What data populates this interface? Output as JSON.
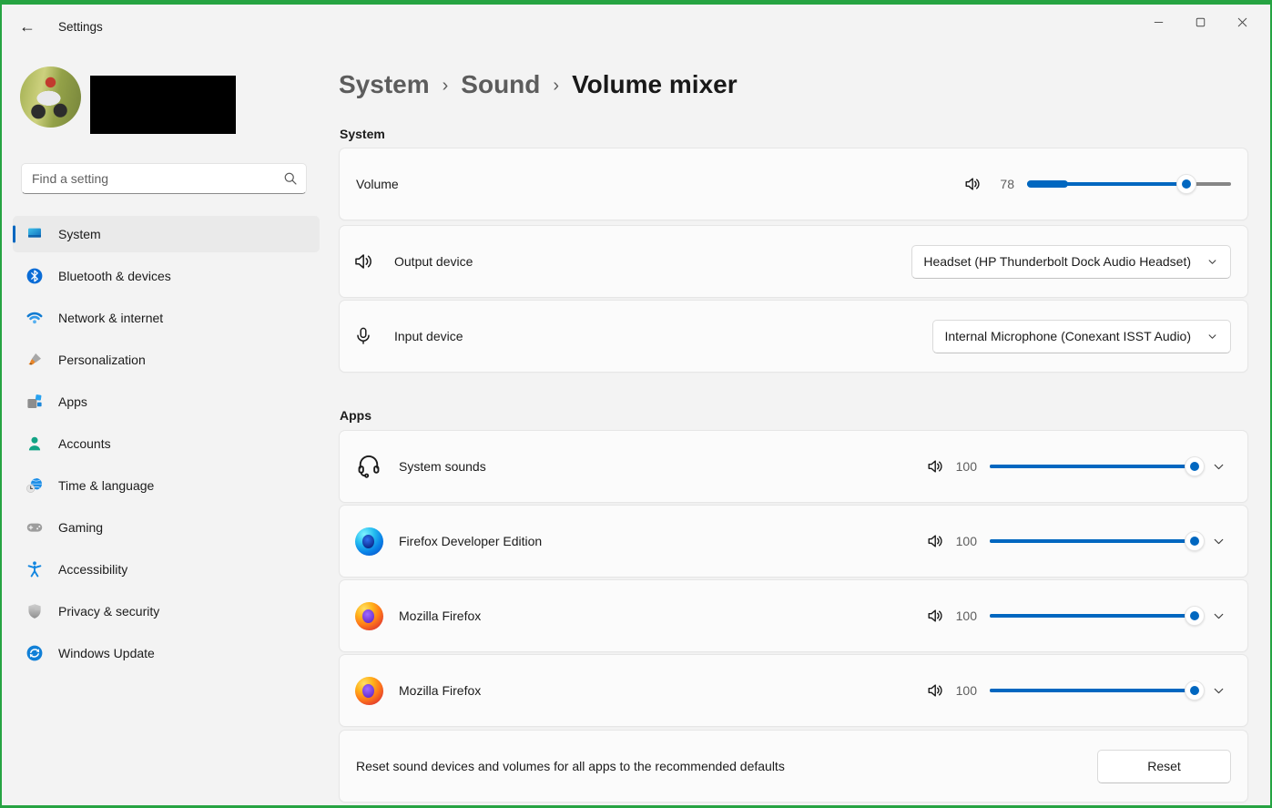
{
  "frame": {
    "border_color": "#26a342"
  },
  "window": {
    "title": "Settings"
  },
  "titlebar": {
    "back_glyph": "←"
  },
  "sidebar": {
    "search_placeholder": "Find a setting",
    "items": [
      {
        "label": "System",
        "icon": "system-icon",
        "selected": true
      },
      {
        "label": "Bluetooth & devices",
        "icon": "bluetooth-icon",
        "selected": false
      },
      {
        "label": "Network & internet",
        "icon": "network-icon",
        "selected": false
      },
      {
        "label": "Personalization",
        "icon": "personalization-icon",
        "selected": false
      },
      {
        "label": "Apps",
        "icon": "apps-icon",
        "selected": false
      },
      {
        "label": "Accounts",
        "icon": "accounts-icon",
        "selected": false
      },
      {
        "label": "Time & language",
        "icon": "time-language-icon",
        "selected": false
      },
      {
        "label": "Gaming",
        "icon": "gaming-icon",
        "selected": false
      },
      {
        "label": "Accessibility",
        "icon": "accessibility-icon",
        "selected": false
      },
      {
        "label": "Privacy & security",
        "icon": "privacy-icon",
        "selected": false
      },
      {
        "label": "Windows Update",
        "icon": "windows-update-icon",
        "selected": false
      }
    ]
  },
  "breadcrumb": {
    "separator": "›",
    "items": [
      "System",
      "Sound"
    ],
    "current": "Volume mixer"
  },
  "system_section": {
    "heading": "System",
    "volume": {
      "label": "Volume",
      "value": 78,
      "max": 100
    },
    "output_device": {
      "label": "Output device",
      "value": "Headset (HP Thunderbolt Dock Audio Headset)"
    },
    "input_device": {
      "label": "Input device",
      "value": "Internal Microphone (Conexant ISST Audio)"
    }
  },
  "apps_section": {
    "heading": "Apps",
    "rows": [
      {
        "name": "System sounds",
        "icon": "system-sounds-icon",
        "volume": 100
      },
      {
        "name": "Firefox Developer Edition",
        "icon": "firefox-developer-icon",
        "volume": 100
      },
      {
        "name": "Mozilla Firefox",
        "icon": "firefox-icon",
        "volume": 100
      },
      {
        "name": "Mozilla Firefox",
        "icon": "firefox-icon",
        "volume": 100
      }
    ]
  },
  "reset_row": {
    "description": "Reset sound devices and volumes for all apps to the recommended defaults",
    "button_label": "Reset"
  },
  "colors": {
    "accent": "#0067c0",
    "frame_green": "#26a342",
    "card_bg": "#fbfbfb",
    "window_bg": "#f3f3f3"
  }
}
